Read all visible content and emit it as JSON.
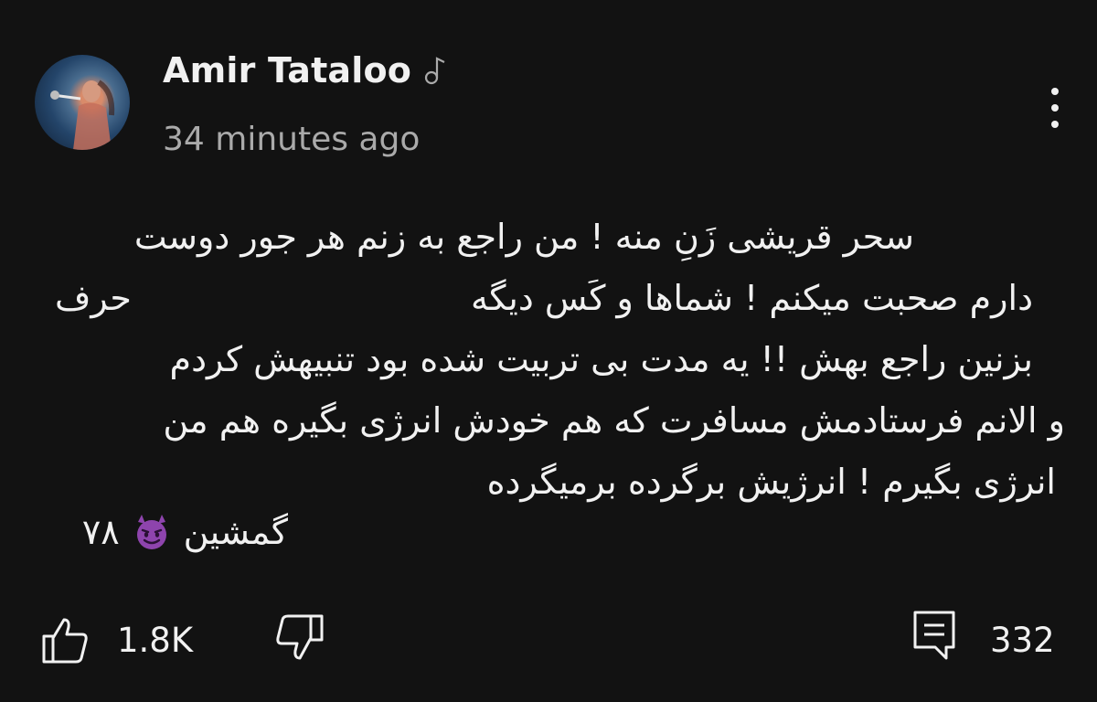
{
  "author": {
    "name": "Amir Tataloo",
    "timestamp": "34 minutes ago",
    "avatar_icon": "profile-photo",
    "badge_icon": "music-note-icon"
  },
  "post": {
    "lines": [
      "سحر قریشی زَنِ منه ! من راجع به زنم هر جور دوست",
      "دارم صحبت میکنم ! شماها و کَس دیگه",
      "حرف",
      "بزنین راجع بهش !! یه مدت بی تربیت شده بود تنبیهش کردم",
      "و الانم فرستادمش مسافرت که هم خودش انرژی بگیره هم من",
      "انرژی بگیرم ! انرژیش برگرده برمیگرده"
    ],
    "signature_text": "گمشین",
    "signature_emoji": "smiling-face-with-horns-emoji",
    "signature_number": "۷۸"
  },
  "actions": {
    "like_count": "1.8K",
    "reply_count": "332",
    "like_icon": "thumbs-up-icon",
    "dislike_icon": "thumbs-down-icon",
    "comment_icon": "comment-icon",
    "menu_icon": "more-vertical-icon"
  },
  "colors": {
    "background": "#121212",
    "text_primary": "#f1f1f1",
    "text_secondary": "#aaaaaa",
    "emoji_purple": "#8e44ad"
  }
}
